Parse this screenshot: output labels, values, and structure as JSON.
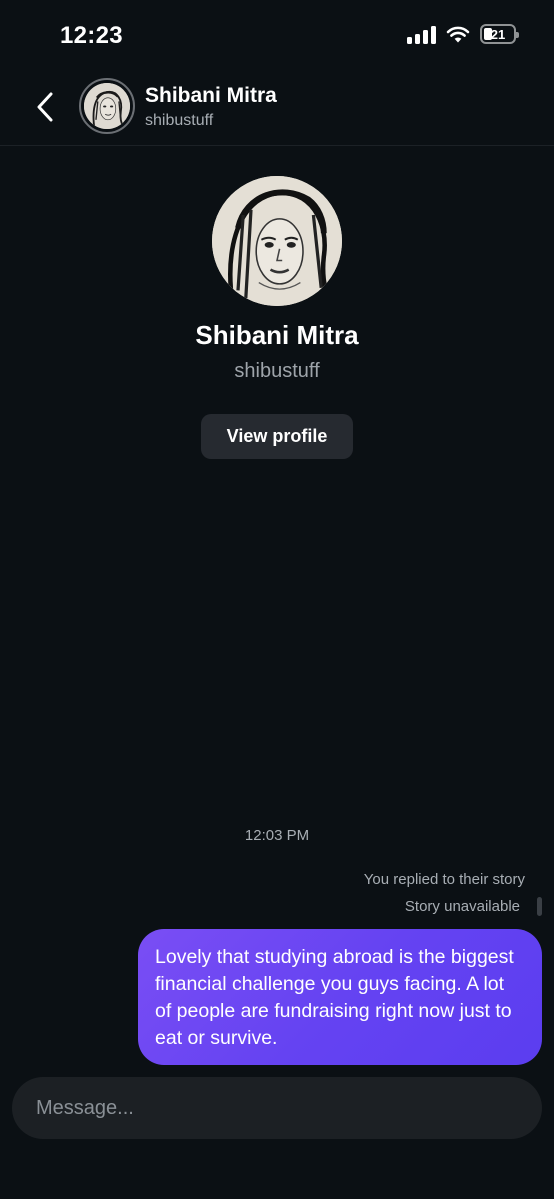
{
  "status_bar": {
    "time": "12:23",
    "battery": "21",
    "icons": [
      "signal-icon",
      "wifi-icon",
      "battery-icon"
    ]
  },
  "header": {
    "back_icon": "chevron-left-icon",
    "name": "Shibani Mitra",
    "username": "shibustuff"
  },
  "profile": {
    "name": "Shibani Mitra",
    "username": "shibustuff",
    "view_profile_label": "View profile"
  },
  "conversation": {
    "timestamp": "12:03 PM",
    "reply_note": "You replied to their story",
    "story_status": "Story unavailable",
    "messages": [
      {
        "sender": "me",
        "text": "Lovely that studying abroad is the biggest financial challenge you guys facing. A lot of people are fundraising right now just to eat or survive."
      }
    ]
  },
  "composer": {
    "placeholder": "Message..."
  },
  "colors": {
    "background": "#0b1014",
    "bubble_start": "#7a4ef4",
    "bubble_end": "#5b3df0",
    "button_bg": "#262a30",
    "muted_text": "#a8aeb4"
  }
}
